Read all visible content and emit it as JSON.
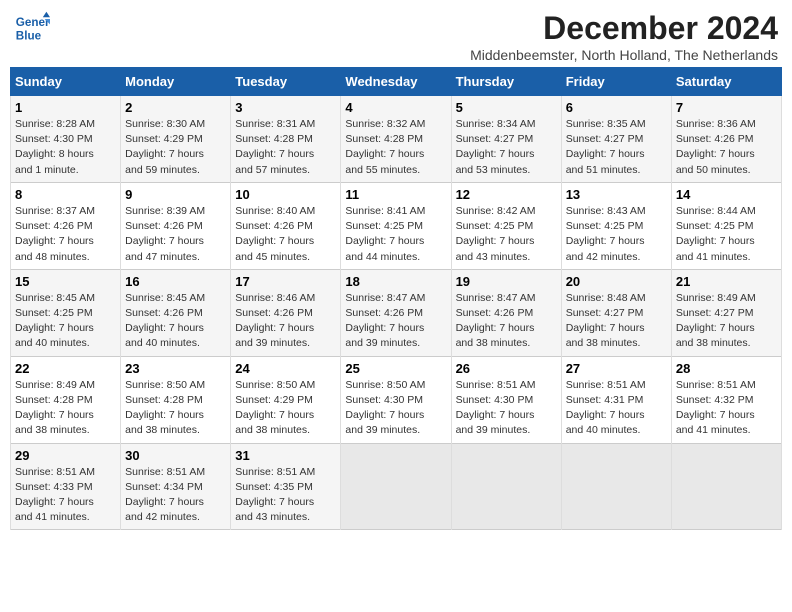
{
  "logo": {
    "line1": "General",
    "line2": "Blue"
  },
  "title": "December 2024",
  "subtitle": "Middenbeemster, North Holland, The Netherlands",
  "days_of_week": [
    "Sunday",
    "Monday",
    "Tuesday",
    "Wednesday",
    "Thursday",
    "Friday",
    "Saturday"
  ],
  "weeks": [
    [
      {
        "day": "1",
        "info": "Sunrise: 8:28 AM\nSunset: 4:30 PM\nDaylight: 8 hours\nand 1 minute."
      },
      {
        "day": "2",
        "info": "Sunrise: 8:30 AM\nSunset: 4:29 PM\nDaylight: 7 hours\nand 59 minutes."
      },
      {
        "day": "3",
        "info": "Sunrise: 8:31 AM\nSunset: 4:28 PM\nDaylight: 7 hours\nand 57 minutes."
      },
      {
        "day": "4",
        "info": "Sunrise: 8:32 AM\nSunset: 4:28 PM\nDaylight: 7 hours\nand 55 minutes."
      },
      {
        "day": "5",
        "info": "Sunrise: 8:34 AM\nSunset: 4:27 PM\nDaylight: 7 hours\nand 53 minutes."
      },
      {
        "day": "6",
        "info": "Sunrise: 8:35 AM\nSunset: 4:27 PM\nDaylight: 7 hours\nand 51 minutes."
      },
      {
        "day": "7",
        "info": "Sunrise: 8:36 AM\nSunset: 4:26 PM\nDaylight: 7 hours\nand 50 minutes."
      }
    ],
    [
      {
        "day": "8",
        "info": "Sunrise: 8:37 AM\nSunset: 4:26 PM\nDaylight: 7 hours\nand 48 minutes."
      },
      {
        "day": "9",
        "info": "Sunrise: 8:39 AM\nSunset: 4:26 PM\nDaylight: 7 hours\nand 47 minutes."
      },
      {
        "day": "10",
        "info": "Sunrise: 8:40 AM\nSunset: 4:26 PM\nDaylight: 7 hours\nand 45 minutes."
      },
      {
        "day": "11",
        "info": "Sunrise: 8:41 AM\nSunset: 4:25 PM\nDaylight: 7 hours\nand 44 minutes."
      },
      {
        "day": "12",
        "info": "Sunrise: 8:42 AM\nSunset: 4:25 PM\nDaylight: 7 hours\nand 43 minutes."
      },
      {
        "day": "13",
        "info": "Sunrise: 8:43 AM\nSunset: 4:25 PM\nDaylight: 7 hours\nand 42 minutes."
      },
      {
        "day": "14",
        "info": "Sunrise: 8:44 AM\nSunset: 4:25 PM\nDaylight: 7 hours\nand 41 minutes."
      }
    ],
    [
      {
        "day": "15",
        "info": "Sunrise: 8:45 AM\nSunset: 4:25 PM\nDaylight: 7 hours\nand 40 minutes."
      },
      {
        "day": "16",
        "info": "Sunrise: 8:45 AM\nSunset: 4:26 PM\nDaylight: 7 hours\nand 40 minutes."
      },
      {
        "day": "17",
        "info": "Sunrise: 8:46 AM\nSunset: 4:26 PM\nDaylight: 7 hours\nand 39 minutes."
      },
      {
        "day": "18",
        "info": "Sunrise: 8:47 AM\nSunset: 4:26 PM\nDaylight: 7 hours\nand 39 minutes."
      },
      {
        "day": "19",
        "info": "Sunrise: 8:47 AM\nSunset: 4:26 PM\nDaylight: 7 hours\nand 38 minutes."
      },
      {
        "day": "20",
        "info": "Sunrise: 8:48 AM\nSunset: 4:27 PM\nDaylight: 7 hours\nand 38 minutes."
      },
      {
        "day": "21",
        "info": "Sunrise: 8:49 AM\nSunset: 4:27 PM\nDaylight: 7 hours\nand 38 minutes."
      }
    ],
    [
      {
        "day": "22",
        "info": "Sunrise: 8:49 AM\nSunset: 4:28 PM\nDaylight: 7 hours\nand 38 minutes."
      },
      {
        "day": "23",
        "info": "Sunrise: 8:50 AM\nSunset: 4:28 PM\nDaylight: 7 hours\nand 38 minutes."
      },
      {
        "day": "24",
        "info": "Sunrise: 8:50 AM\nSunset: 4:29 PM\nDaylight: 7 hours\nand 38 minutes."
      },
      {
        "day": "25",
        "info": "Sunrise: 8:50 AM\nSunset: 4:30 PM\nDaylight: 7 hours\nand 39 minutes."
      },
      {
        "day": "26",
        "info": "Sunrise: 8:51 AM\nSunset: 4:30 PM\nDaylight: 7 hours\nand 39 minutes."
      },
      {
        "day": "27",
        "info": "Sunrise: 8:51 AM\nSunset: 4:31 PM\nDaylight: 7 hours\nand 40 minutes."
      },
      {
        "day": "28",
        "info": "Sunrise: 8:51 AM\nSunset: 4:32 PM\nDaylight: 7 hours\nand 41 minutes."
      }
    ],
    [
      {
        "day": "29",
        "info": "Sunrise: 8:51 AM\nSunset: 4:33 PM\nDaylight: 7 hours\nand 41 minutes."
      },
      {
        "day": "30",
        "info": "Sunrise: 8:51 AM\nSunset: 4:34 PM\nDaylight: 7 hours\nand 42 minutes."
      },
      {
        "day": "31",
        "info": "Sunrise: 8:51 AM\nSunset: 4:35 PM\nDaylight: 7 hours\nand 43 minutes."
      },
      {
        "day": "",
        "info": ""
      },
      {
        "day": "",
        "info": ""
      },
      {
        "day": "",
        "info": ""
      },
      {
        "day": "",
        "info": ""
      }
    ]
  ]
}
